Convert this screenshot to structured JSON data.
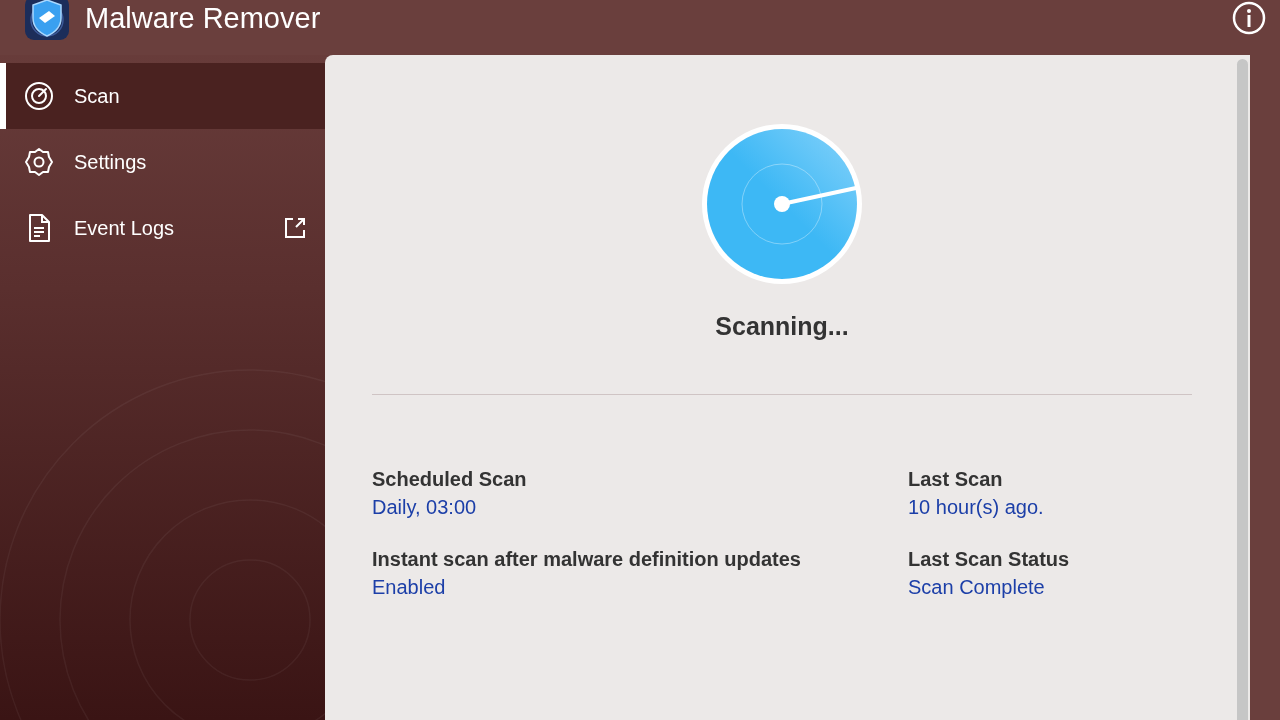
{
  "window": {
    "title": "Malware Remover"
  },
  "sidebar": {
    "items": [
      {
        "kind": "scan",
        "label": "Scan",
        "selected": true,
        "external": false
      },
      {
        "kind": "settings",
        "label": "Settings",
        "selected": false,
        "external": false
      },
      {
        "kind": "logs",
        "label": "Event Logs",
        "selected": false,
        "external": true
      }
    ]
  },
  "scan": {
    "status": "Scanning..."
  },
  "info": [
    {
      "label": "Scheduled Scan",
      "value": "Daily, 03:00"
    },
    {
      "label": "Last Scan",
      "value": "10 hour(s) ago."
    },
    {
      "label": "Instant scan after malware definition updates",
      "value": "Enabled"
    },
    {
      "label": "Last Scan Status",
      "value": "Scan Complete"
    }
  ]
}
